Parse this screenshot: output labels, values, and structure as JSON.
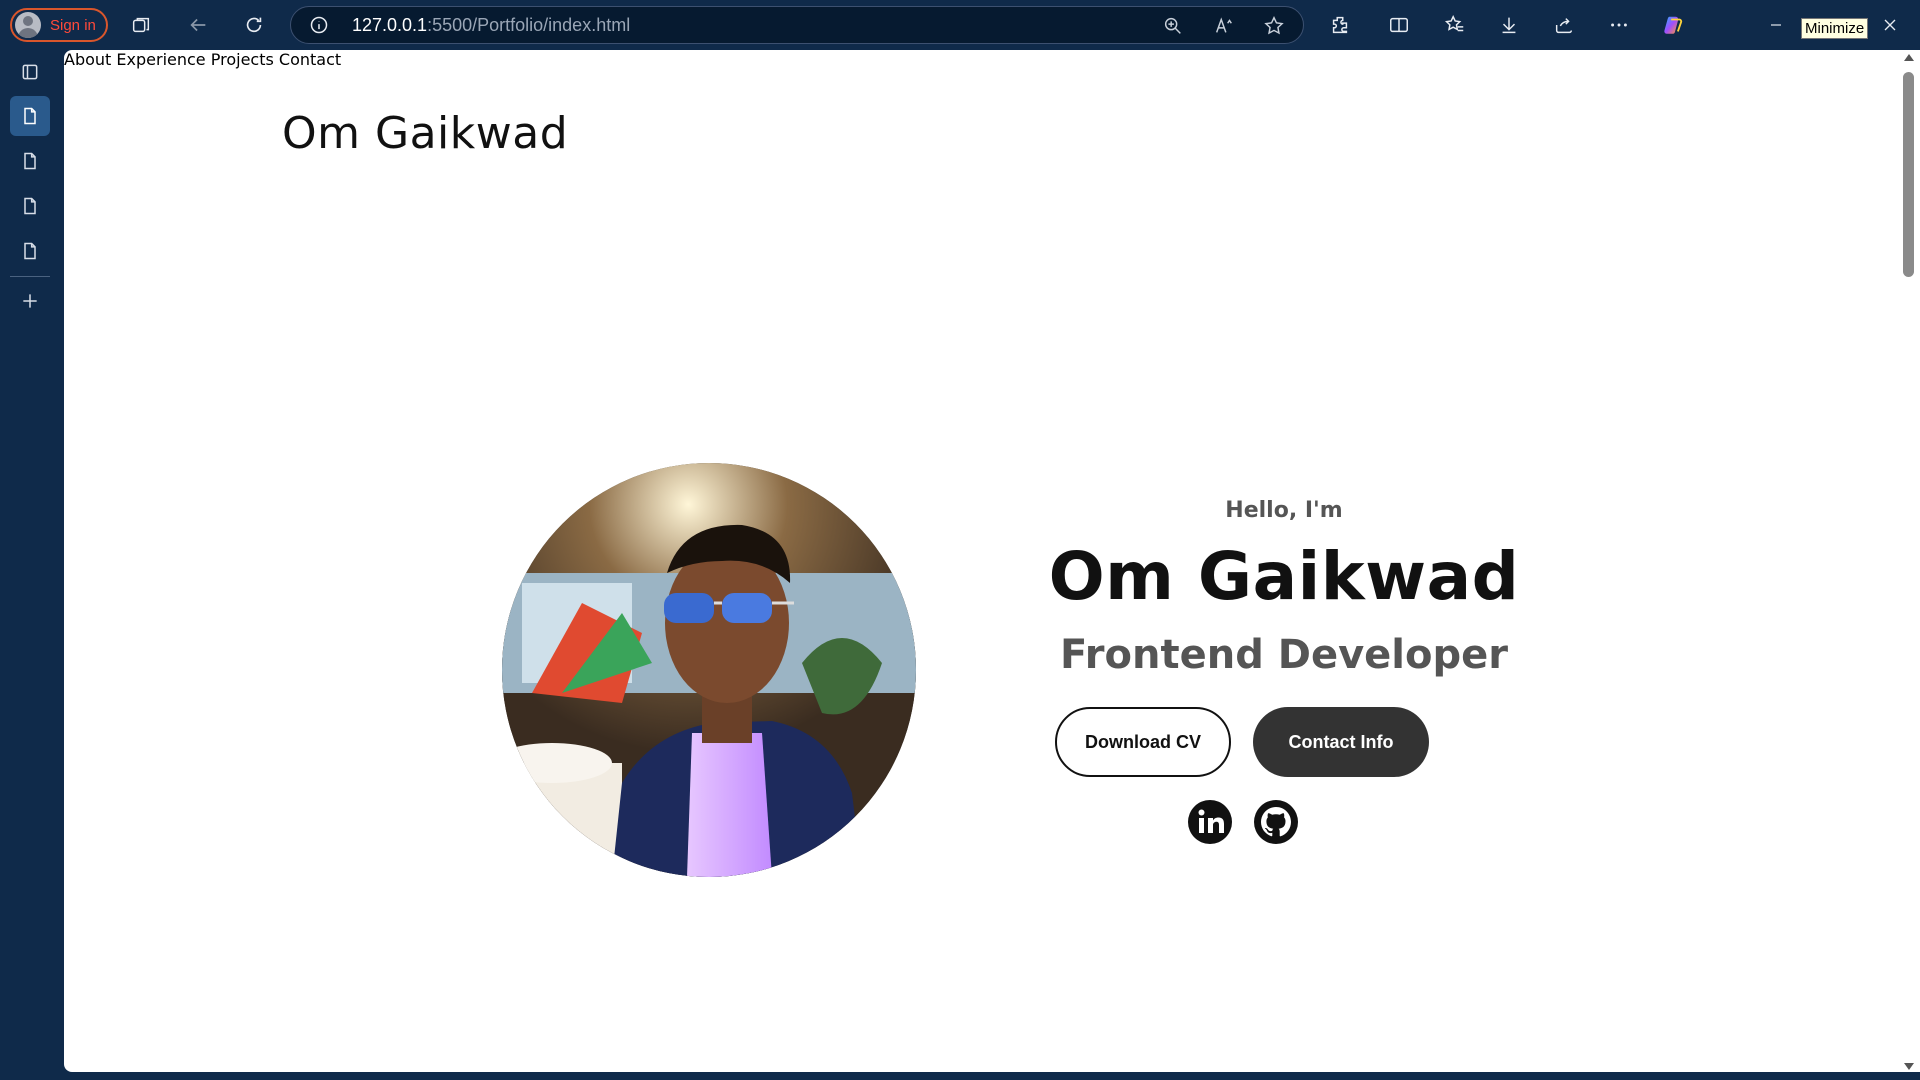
{
  "browser": {
    "profile_label": "Sign in",
    "url_host": "127.0.0.1",
    "url_rest": ":5500/Portfolio/index.html",
    "tooltip": "Minimize",
    "colors": {
      "chrome": "#0f2a4a",
      "profile_border": "#d9562c",
      "signin_text": "#ff4a3a"
    }
  },
  "site": {
    "logo": "Om Gaikwad",
    "nav": [
      "About",
      "Experience",
      "Projects",
      "Contact"
    ],
    "hero": {
      "greeting": "Hello, I'm",
      "name": "Om Gaikwad",
      "role": "Frontend Developer",
      "download_cv_label": "Download CV",
      "contact_label": "Contact Info",
      "socials": [
        "linkedin-icon",
        "github-icon"
      ]
    }
  }
}
